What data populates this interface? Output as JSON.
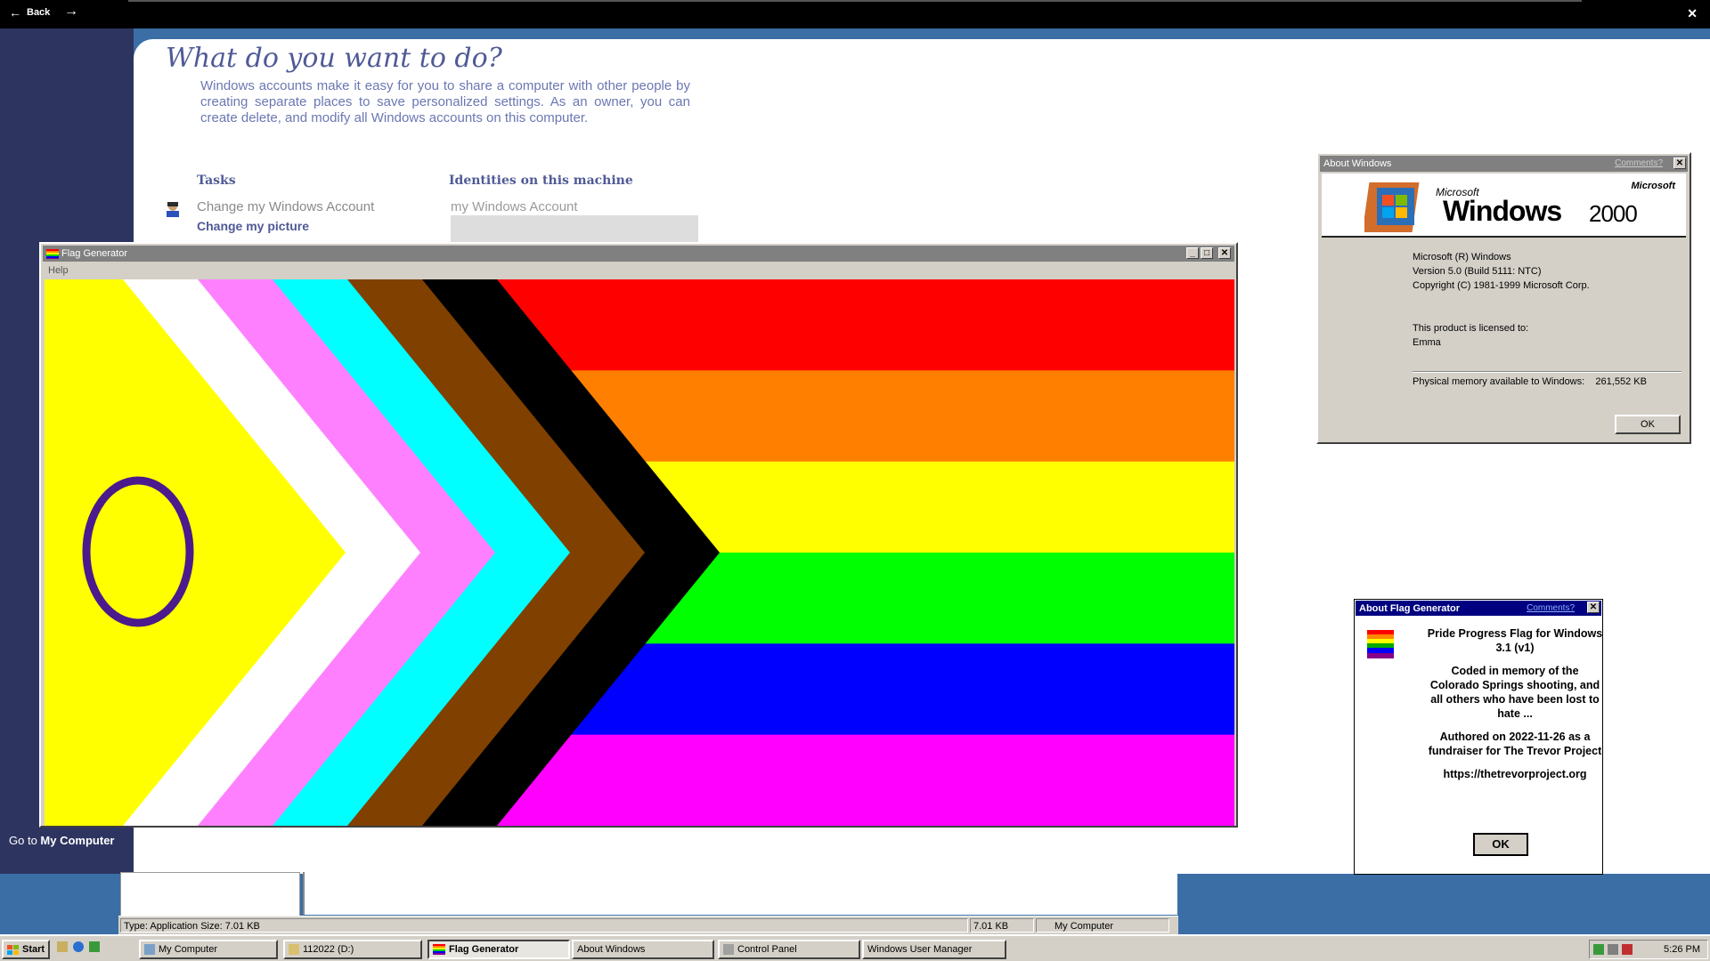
{
  "topbar": {
    "back_label": "Back"
  },
  "user_accounts": {
    "title": "What do you want to do?",
    "description": "Windows accounts make it easy for you to share a computer with other people by creating separate places to save personalized settings. As an owner, you can create delete, and modify all Windows accounts on this computer.",
    "tasks_heading": "Tasks",
    "task_1": "Change my Windows Account",
    "task_2": "Change my picture",
    "identities_heading": "Identities on this machine",
    "identity_1": "my Windows Account",
    "go_to_prefix": "Go to",
    "go_to_target": "My Computer"
  },
  "explorer_status": {
    "type_text": "Type: Application Size: 7.01 KB",
    "size": "7.01 KB",
    "location": "My Computer"
  },
  "flag_window": {
    "title": "Flag Generator",
    "menu_help": "Help",
    "chevron_colors": [
      "#ffff00",
      "#ffffff",
      "#ff80ff",
      "#00ffff",
      "#804000",
      "#000000"
    ],
    "stripe_colors": [
      "#ff0000",
      "#ff8000",
      "#ffff00",
      "#00ff00",
      "#0000ff",
      "#ff00ff"
    ],
    "circle_color": "#4b1a8c"
  },
  "about_windows": {
    "title": "About Windows",
    "comments": "Comments?",
    "brand_microsoft": "Microsoft",
    "brand_small": "Microsoft",
    "brand_windows": "Windows",
    "brand_version": "2000",
    "line_1": "Microsoft (R) Windows",
    "line_2": "Version 5.0 (Build 5111: NTC)",
    "line_3": "Copyright (C) 1981-1999 Microsoft Corp.",
    "licensed_label": "This product is licensed to:",
    "licensed_to": "Emma",
    "memory_label": "Physical memory available to Windows:",
    "memory_value": "261,552 KB",
    "ok": "OK"
  },
  "about_flag": {
    "title": "About Flag Generator",
    "comments": "Comments?",
    "p1": "Pride Progress Flag for Windows 3.1 (v1)",
    "p2": "Coded in memory of the Colorado Springs shooting, and all others who have been lost to hate ...",
    "p3": "Authored on 2022-11-26 as a fundraiser for The Trevor Project",
    "p4": "https://thetrevorproject.org",
    "ok": "OK"
  },
  "taskbar": {
    "start": "Start",
    "items": [
      "My Computer",
      "112022 (D:)",
      "Flag Generator",
      "About Windows",
      "Control Panel",
      "Windows User Manager"
    ],
    "clock": "5:26 PM"
  }
}
